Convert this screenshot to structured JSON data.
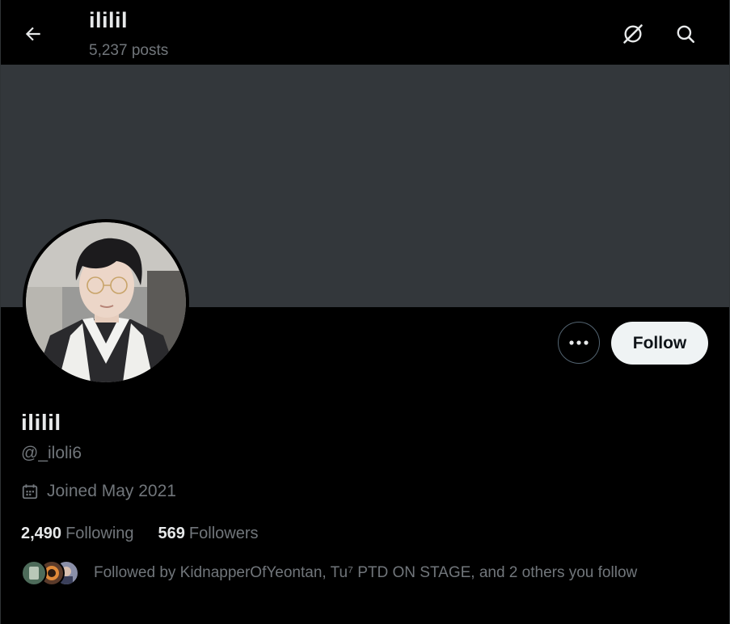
{
  "header": {
    "title": "ililil",
    "posts": "5,237 posts",
    "back_icon": "arrow-left-icon",
    "grok_icon": "grok-icon",
    "search_icon": "search-icon"
  },
  "banner": {
    "color": "#33373b"
  },
  "profile": {
    "display_name": "ililil",
    "handle": "@_iloli6",
    "joined": "Joined May 2021",
    "following_count": "2,490",
    "following_label": "Following",
    "followers_count": "569",
    "followers_label": "Followers",
    "followed_by": "Followed by KidnapperOfYeontan, Tu⁷ PTD ON STAGE, and 2 others you follow"
  },
  "actions": {
    "more_icon": "more-dots-icon",
    "follow_label": "Follow"
  },
  "colors": {
    "background": "#000000",
    "text_primary": "#e7e9ea",
    "text_secondary": "#71767b",
    "follow_button_bg": "#eff3f4"
  }
}
